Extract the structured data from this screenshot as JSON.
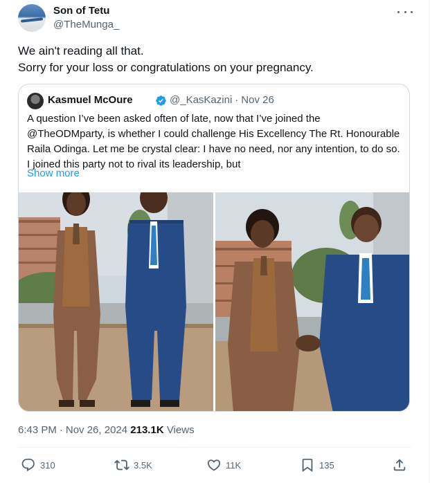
{
  "author": {
    "name": "Son of Tetu",
    "handle": "@TheMunga_"
  },
  "tweet": {
    "line1": "We ain't reading all that.",
    "line2": "Sorry for your loss or congratulations on your pregnancy."
  },
  "quoted": {
    "name": "Kasmuel McOure",
    "handle": "@_KasKazini",
    "separator": "·",
    "date": "Nov 26",
    "text": "A question I’ve been asked often of late, now that I’ve joined the @TheODMparty, is whether I could challenge His Excellency The Rt. Honourable Raila Odinga. Let me be crystal clear: I have no need, nor any intention, to do so. I joined this party not to rival its leadership, but",
    "show_more": "Show more",
    "images": [
      "photo",
      "photo"
    ]
  },
  "meta": {
    "time": "6:43 PM",
    "separator": "·",
    "date": "Nov 26, 2024",
    "views_count": "213.1K",
    "views_label": "Views"
  },
  "actions": {
    "replies": "310",
    "reposts": "3.5K",
    "likes": "11K",
    "bookmarks": "135"
  },
  "icons": {
    "more": "more-horizontal-icon",
    "verified": "verified-badge-icon",
    "reply": "reply-icon",
    "repost": "repost-icon",
    "like": "heart-icon",
    "bookmark": "bookmark-icon",
    "share": "share-icon"
  },
  "colors": {
    "text": "#0f1419",
    "secondary": "#536471",
    "link": "#1d9bf0",
    "border": "#cfd9de"
  }
}
